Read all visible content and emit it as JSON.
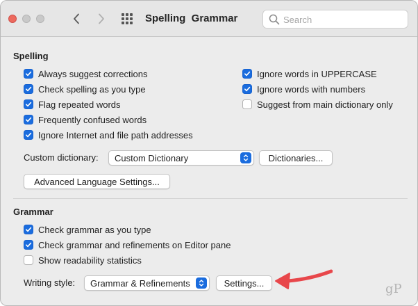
{
  "window": {
    "title": "Spelling  Grammar",
    "search_placeholder": "Search"
  },
  "spelling": {
    "heading": "Spelling",
    "left_options": [
      {
        "label": "Always suggest corrections",
        "checked": true
      },
      {
        "label": "Check spelling as you type",
        "checked": true
      },
      {
        "label": "Flag repeated words",
        "checked": true
      },
      {
        "label": "Frequently confused words",
        "checked": true
      },
      {
        "label": "Ignore Internet and file path addresses",
        "checked": true
      }
    ],
    "right_options": [
      {
        "label": "Ignore words in UPPERCASE",
        "checked": true
      },
      {
        "label": "Ignore words with numbers",
        "checked": true
      },
      {
        "label": "Suggest from main dictionary only",
        "checked": false
      }
    ],
    "custom_dictionary_label": "Custom dictionary:",
    "custom_dictionary_value": "Custom Dictionary",
    "dictionaries_button": "Dictionaries...",
    "advanced_button": "Advanced Language Settings..."
  },
  "grammar": {
    "heading": "Grammar",
    "options": [
      {
        "label": "Check grammar as you type",
        "checked": true
      },
      {
        "label": "Check grammar and refinements on Editor pane",
        "checked": true
      },
      {
        "label": "Show readability statistics",
        "checked": false
      }
    ],
    "writing_style_label": "Writing style:",
    "writing_style_value": "Grammar & Refinements",
    "settings_button": "Settings..."
  },
  "watermark": "gP",
  "colors": {
    "accent": "#1a6cde",
    "arrow": "#e8474b",
    "close": "#ed6a5e"
  },
  "icons": [
    "back-chevron-icon",
    "forward-chevron-icon",
    "grid-icon",
    "search-icon",
    "checkmark-icon",
    "popup-stepper-icon",
    "annotation-arrow"
  ]
}
